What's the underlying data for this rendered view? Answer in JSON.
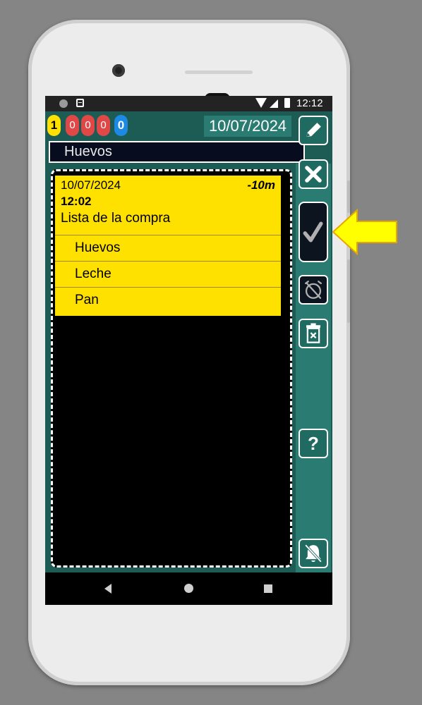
{
  "status_bar": {
    "time": "12:12"
  },
  "counters": [
    {
      "value": "1",
      "color": "#ffe100"
    },
    {
      "value": "0",
      "color": "#e04848"
    },
    {
      "value": "0",
      "color": "#e04848"
    },
    {
      "value": "0",
      "color": "#e04848"
    },
    {
      "value": "0",
      "color": "#1e88e5"
    }
  ],
  "header": {
    "date": "10/07/2024",
    "title_value": "Huevos"
  },
  "note": {
    "date": "10/07/2024",
    "time_ago": "-10m",
    "time": "12:02",
    "title": "Lista de la compra",
    "items": [
      {
        "label": "Huevos"
      },
      {
        "label": "Leche"
      },
      {
        "label": "Pan"
      }
    ],
    "color": "#ffe100"
  },
  "right_rail": {
    "buttons": [
      "edit-icon",
      "close-icon",
      "check-icon",
      "alarm-off-icon",
      "trash-icon",
      "help-icon",
      "bell-off-icon"
    ],
    "help_glyph": "?"
  },
  "annotation": {
    "arrow_color": "#ffff00"
  }
}
